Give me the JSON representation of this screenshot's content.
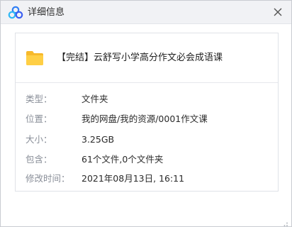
{
  "window": {
    "title": "详细信息",
    "logo_icon": "baidu-netdisk-cloud-icon",
    "close_icon": "close-icon"
  },
  "file": {
    "icon": "folder-icon",
    "name": "【完结】云舒写小学高分作文必会成语课"
  },
  "properties": [
    {
      "label": "类型：",
      "value": "文件夹"
    },
    {
      "label": "位置：",
      "value": "我的网盘/我的资源/0001作文课"
    },
    {
      "label": "大小：",
      "value": "3.25GB"
    },
    {
      "label": "包含：",
      "value": "61个文件,0个文件夹"
    },
    {
      "label": "修改时间：",
      "value": "2021年08月13日, 16:11"
    }
  ],
  "colors": {
    "accent_blue": "#3b7ff2",
    "folder_yellow": "#ffcb3d",
    "label_gray": "#8a8f99"
  }
}
